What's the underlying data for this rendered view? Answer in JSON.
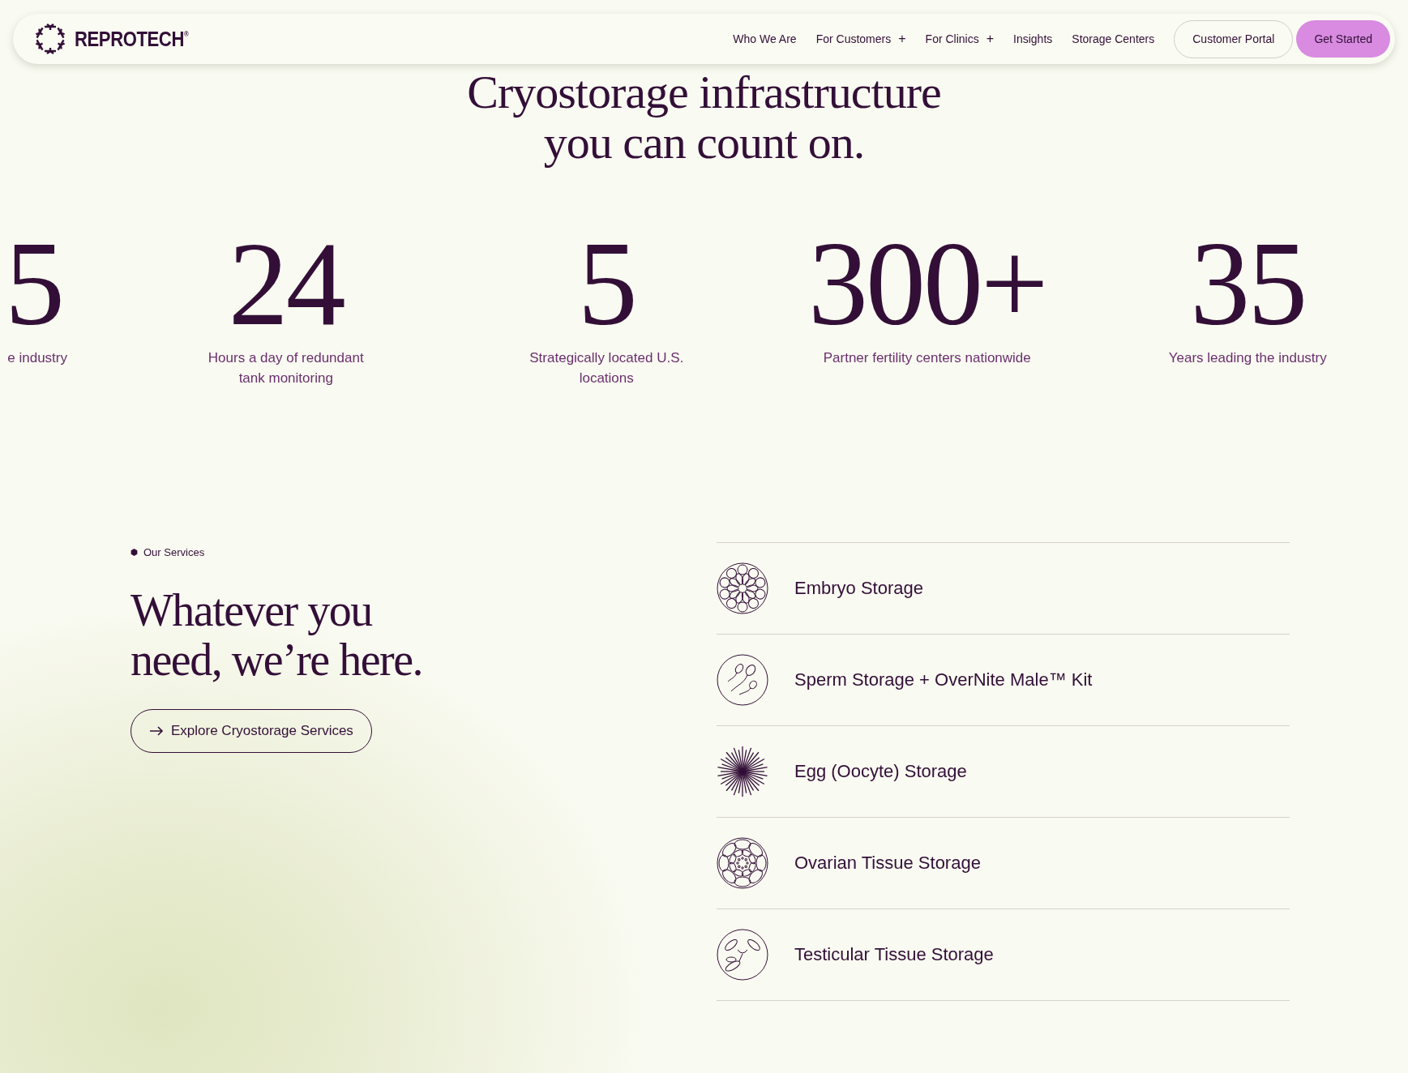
{
  "nav": {
    "brand": "REPROTECH",
    "brand_mark": "®",
    "links": [
      {
        "label": "Who We Are"
      },
      {
        "label": "For Customers",
        "expander": "+"
      },
      {
        "label": "For Clinics",
        "expander": "+"
      },
      {
        "label": "Insights"
      },
      {
        "label": "Storage Centers"
      }
    ],
    "portal_button": "Customer Portal",
    "cta_button": "Get Started"
  },
  "hero": {
    "title_lines": [
      "Cryostorage infrastructure",
      "you can count on."
    ]
  },
  "stats": [
    {
      "value": "5",
      "label": "e industry"
    },
    {
      "value": "24",
      "label": "Hours a day of redundant tank monitoring"
    },
    {
      "value": "5",
      "label": "Strategically located U.S. locations"
    },
    {
      "value": "300+",
      "label": "Partner fertility centers nationwide"
    },
    {
      "value": "35",
      "label": "Years leading the industry"
    }
  ],
  "services": {
    "eyebrow": "Our Services",
    "heading_lines": [
      "Whatever you",
      "need, we’re here."
    ],
    "button": "Explore Cryostorage Services",
    "items": [
      {
        "kind": "embryo",
        "label": "Embryo Storage"
      },
      {
        "kind": "sperm",
        "label": "Sperm Storage + OverNite Male™ Kit"
      },
      {
        "kind": "egg",
        "label": "Egg (Oocyte) Storage"
      },
      {
        "kind": "ovarian",
        "label": "Ovarian Tissue Storage"
      },
      {
        "kind": "testicular",
        "label": "Testicular Tissue Storage"
      }
    ]
  }
}
